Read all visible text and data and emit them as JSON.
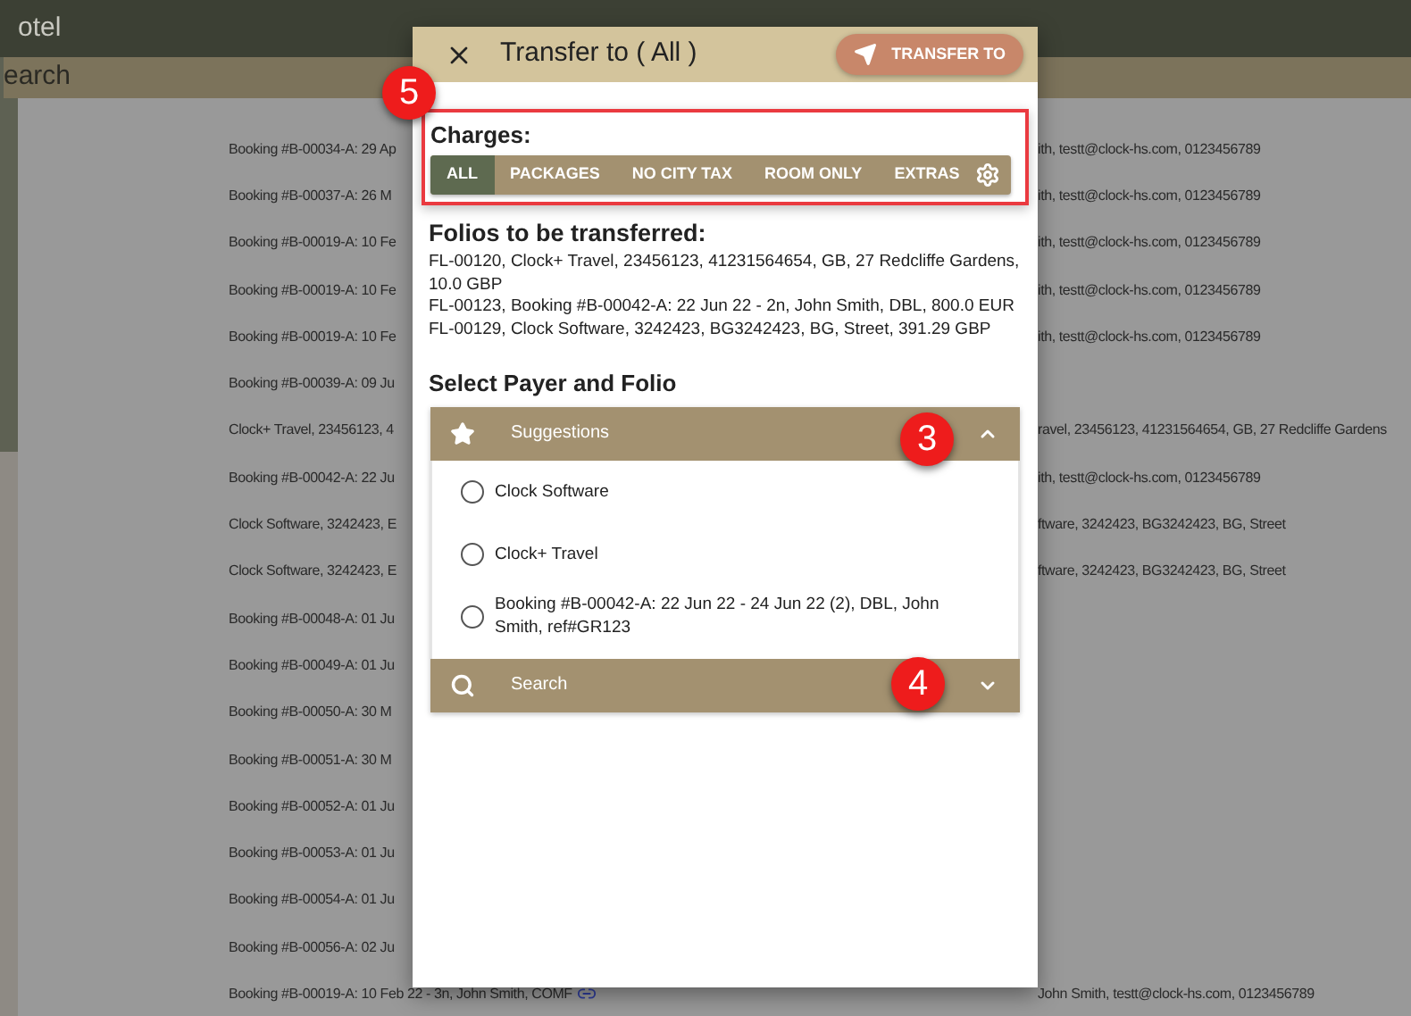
{
  "app_bar": {
    "title": "otel"
  },
  "search_bar": {
    "label": "earch"
  },
  "background_rows": [
    {
      "left": "Booking #B-00034-A: 29 Ap",
      "right": "ith, testt@clock-hs.com, 0123456789",
      "link": false
    },
    {
      "left": "Booking #B-00037-A: 26 M",
      "right": "ith, testt@clock-hs.com, 0123456789",
      "link": false
    },
    {
      "left": "Booking #B-00019-A: 10 Fe",
      "right": "ith, testt@clock-hs.com, 0123456789",
      "link": false
    },
    {
      "left": "Booking #B-00019-A: 10 Fe",
      "right": "ith, testt@clock-hs.com, 0123456789",
      "link": false
    },
    {
      "left": "Booking #B-00019-A: 10 Fe",
      "right": "ith, testt@clock-hs.com, 0123456789",
      "link": false
    },
    {
      "left": "Booking #B-00039-A: 09 Ju",
      "link": false
    },
    {
      "left": "Clock+ Travel, 23456123, 4",
      "right": "ravel, 23456123, 41231564654, GB, 27 Redcliffe Gardens",
      "link": false
    },
    {
      "left": "Booking #B-00042-A: 22 Ju",
      "right": "ith, testt@clock-hs.com, 0123456789",
      "link": false
    },
    {
      "left": "Clock Software, 3242423, E",
      "right": "ftware, 3242423, BG3242423, BG, Street",
      "link": false
    },
    {
      "left": "Clock Software, 3242423, E",
      "right": "ftware, 3242423, BG3242423, BG, Street",
      "link": false
    },
    {
      "left": "Booking #B-00048-A: 01 Ju",
      "link": false
    },
    {
      "left": "Booking #B-00049-A: 01 Ju",
      "link": false
    },
    {
      "left": "Booking #B-00050-A: 30 M",
      "link": false
    },
    {
      "left": "Booking #B-00051-A: 30 M",
      "link": false
    },
    {
      "left": "Booking #B-00052-A: 01 Ju",
      "link": false
    },
    {
      "left": "Booking #B-00053-A: 01 Ju",
      "link": false
    },
    {
      "left": "Booking #B-00054-A: 01 Ju",
      "link": false
    },
    {
      "left": "Booking #B-00056-A: 02 Ju",
      "link": false
    },
    {
      "left": "Booking #B-00019-A: 10 Feb 22 - 3n, John Smith, COMF",
      "right": "John Smith, testt@clock-hs.com, 0123456789",
      "link": true
    }
  ],
  "dialog": {
    "title": "Transfer to ( All )",
    "primary_button": "TRANSFER TO",
    "charges": {
      "label": "Charges:",
      "annotation": "5",
      "options": [
        {
          "label": "ALL",
          "selected": true
        },
        {
          "label": "PACKAGES",
          "selected": false
        },
        {
          "label": "NO CITY TAX",
          "selected": false
        },
        {
          "label": "ROOM ONLY",
          "selected": false
        },
        {
          "label": "EXTRAS",
          "selected": false
        }
      ]
    },
    "folios": {
      "heading": "Folios to be transferred:",
      "lines": [
        "FL-00120, Clock+ Travel, 23456123, 41231564654, GB, 27 Redcliffe Gardens, 10.0 GBP",
        "FL-00123, Booking #B-00042-A: 22 Jun 22 - 2n, John Smith, DBL, 800.0 EUR",
        "FL-00129, Clock Software, 3242423, BG3242423, BG, Street, 391.29 GBP"
      ]
    },
    "payer": {
      "heading": "Select Payer and Folio",
      "panels": [
        {
          "kind": "suggestions",
          "title": "Suggestions",
          "expanded": true,
          "annotation": "3",
          "options": [
            {
              "label": "Clock Software",
              "selected": false
            },
            {
              "label": "Clock+ Travel",
              "selected": false
            },
            {
              "label": "Booking #B-00042-A: 22 Jun 22 - 24 Jun 22 (2), DBL, John Smith, ref#GR123",
              "selected": false
            }
          ]
        },
        {
          "kind": "search",
          "title": "Search",
          "expanded": false,
          "annotation": "4"
        }
      ]
    }
  }
}
